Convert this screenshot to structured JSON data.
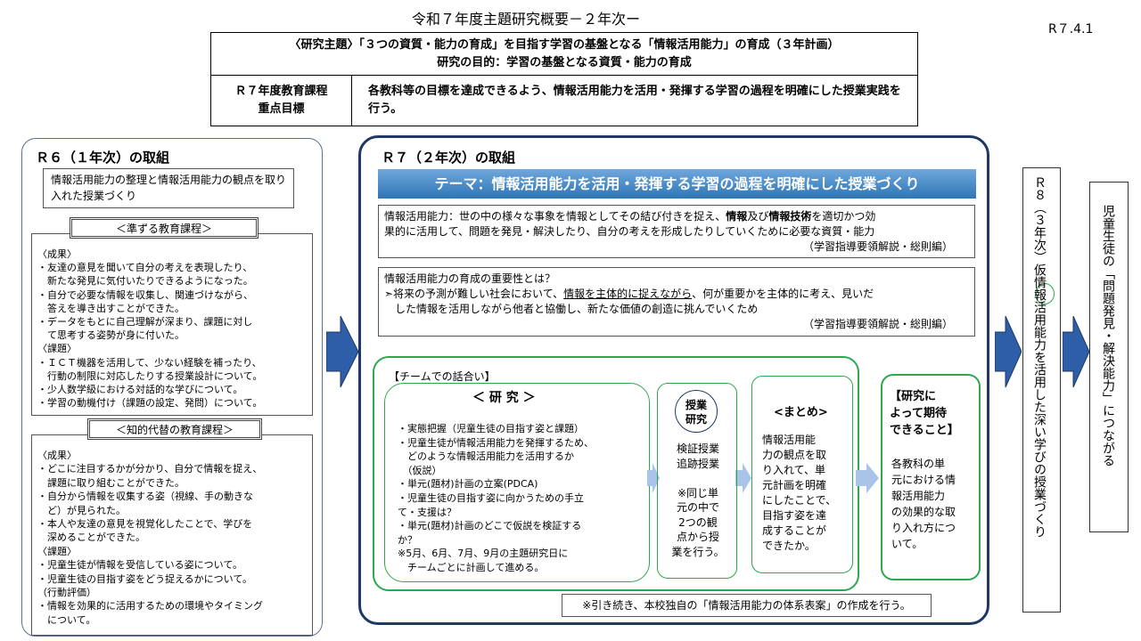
{
  "header": {
    "title": "令和７年度主題研究概要－２年次ー",
    "date": "R７.4.1",
    "theme_line1": "〈研究主題〉「３つの資質・能力の育成」を目指す学習の基盤となる「情報活用能力」の育成（３年計画）",
    "theme_line2": "研究の目的：学習の基盤となる資質・能力の育成",
    "goal_label_1": "Ｒ７年度教育課程",
    "goal_label_2": "重点目標",
    "goal_text": "各教科等の目標を達成できるよう、情報活用能力を活用・発揮する学習の過程を明確にした授業実践を行う。"
  },
  "r6": {
    "title": "Ｒ６（１年次）の取組",
    "summary": "情報活用能力の整理と情報活用能力の観点を取り入れた授業づくり",
    "sec1_head": "＜準ずる教育課程＞",
    "sec1_lines": [
      "〈成果〉",
      "・友達の意見を聞いて自分の考えを表現したり、",
      "　新たな発見に気付いたりできるようになった。",
      "・自分で必要な情報を収集し、関連づけながら、",
      "　答えを導き出すことができた。",
      "・データをもとに自己理解が深まり、課題に対し",
      "　て思考する姿勢が身に付いた。",
      "〈課題〉",
      "・ＩＣＴ機器を活用して、少ない経験を補ったり、",
      "　行動の制限に対応したりする授業設計について。",
      "・少人数学級における対話的な学びについて。",
      "・学習の動機付け（課題の設定、発問）について。"
    ],
    "sec2_head": "＜知的代替の教育課程＞",
    "sec2_lines": [
      "〈成果〉",
      "・どこに注目するかが分かり、自分で情報を捉え、",
      "　課題に取り組むことができた。",
      "・自分から情報を収集する姿（視線、手の動きな",
      "　ど）が見られた。",
      "・本人や友達の意見を視覚化したことで、学びを",
      "　深めることができた。",
      "〈課題〉",
      "・児童生徒が情報を受信している姿について。",
      "・児童生徒の目指す姿をどう捉えるかについて。",
      "（行動評価）",
      "・情報を効果的に活用するための環境やタイミング",
      "　について。"
    ]
  },
  "r7": {
    "title": "Ｒ７（２年次）の取組",
    "theme": "テーマ：情報活用能力を活用・発揮する学習の過程を明確にした授業づくり",
    "def_line1_a": "情報活用能力：世の中の様々な事象を情報としてその結び付きを捉え、",
    "def_line1_b": "情報",
    "def_line1_c": "及び",
    "def_line1_d": "情報技術",
    "def_line1_e": "を適切かつ効",
    "def_line2": "果的に活用して、問題を発見・解決したり、自分の考えを形成したりしていくために必要な資質・能力",
    "def_source": "（学習指導要領解説・総則編）",
    "imp_title": "情報活用能力の育成の重要性とは？",
    "imp_line1_a": "➣将来の予測が難しい社会において、",
    "imp_line1_b": "情報を主体的に捉えながら",
    "imp_line1_c": "、何が重要かを主体的に考え、見いだ",
    "imp_line2": "した情報を活用しながら他者と協働し、新たな価値の創造に挑んでいくため",
    "imp_source": "（学習指導要領解説・総則編）",
    "team_label": "【チームでの話合い】",
    "research_head": "＜ 研 究 ＞",
    "research_lines": [
      "・実態把握（児童生徒の目指す姿と課題）",
      "・児童生徒が情報活用能力を発揮するため、",
      "　どのような情報活用能力を活用するか",
      "　（仮説）",
      "・単元(題材)計画の立案(PDCA)",
      "・児童生徒の目指す姿に向かうための手立",
      "て・支援は？",
      "・単元(題材)計画のどこで仮説を検証する",
      "か？",
      "※5月、6月、7月、9月の主題研究日に",
      "　チームごとに計画して進める。"
    ],
    "lesson_title_1": "授業",
    "lesson_title_2": "研究",
    "lesson_lines": [
      "検証授業",
      "追跡授業",
      "",
      "※同じ単",
      "元の中で",
      "2つの観",
      "点から授",
      "業を行う。"
    ],
    "summary_head": "<まとめ>",
    "summary_lines": [
      "情報活用能",
      "力の観点を取",
      "り入れて、単",
      "元計画を明確",
      "にしたことで、",
      "目指す姿を達",
      "成することが",
      "できたか。"
    ],
    "expect_head_lines": [
      "【研究に",
      "よって期待",
      "できること】"
    ],
    "expect_lines": [
      "各教科の単",
      "元における情",
      "報活用能力",
      "の効果的な取",
      "り入れ方につ",
      "いて。"
    ],
    "note": "※引き続き、本校独自の「情報活用能力の体系表案」の作成を行う。"
  },
  "r8": {
    "text": "Ｒ８（３年次）仮情報活用能力を活用した深い学びの授業づくり"
  },
  "goal": {
    "text": "児童生徒の「問題発見・解決能力」につながる"
  },
  "colors": {
    "navy": "#1f3864",
    "green": "#2ea84c",
    "arrow_blue": "#2f5ea8",
    "theme_blue": "#2f75b5"
  }
}
